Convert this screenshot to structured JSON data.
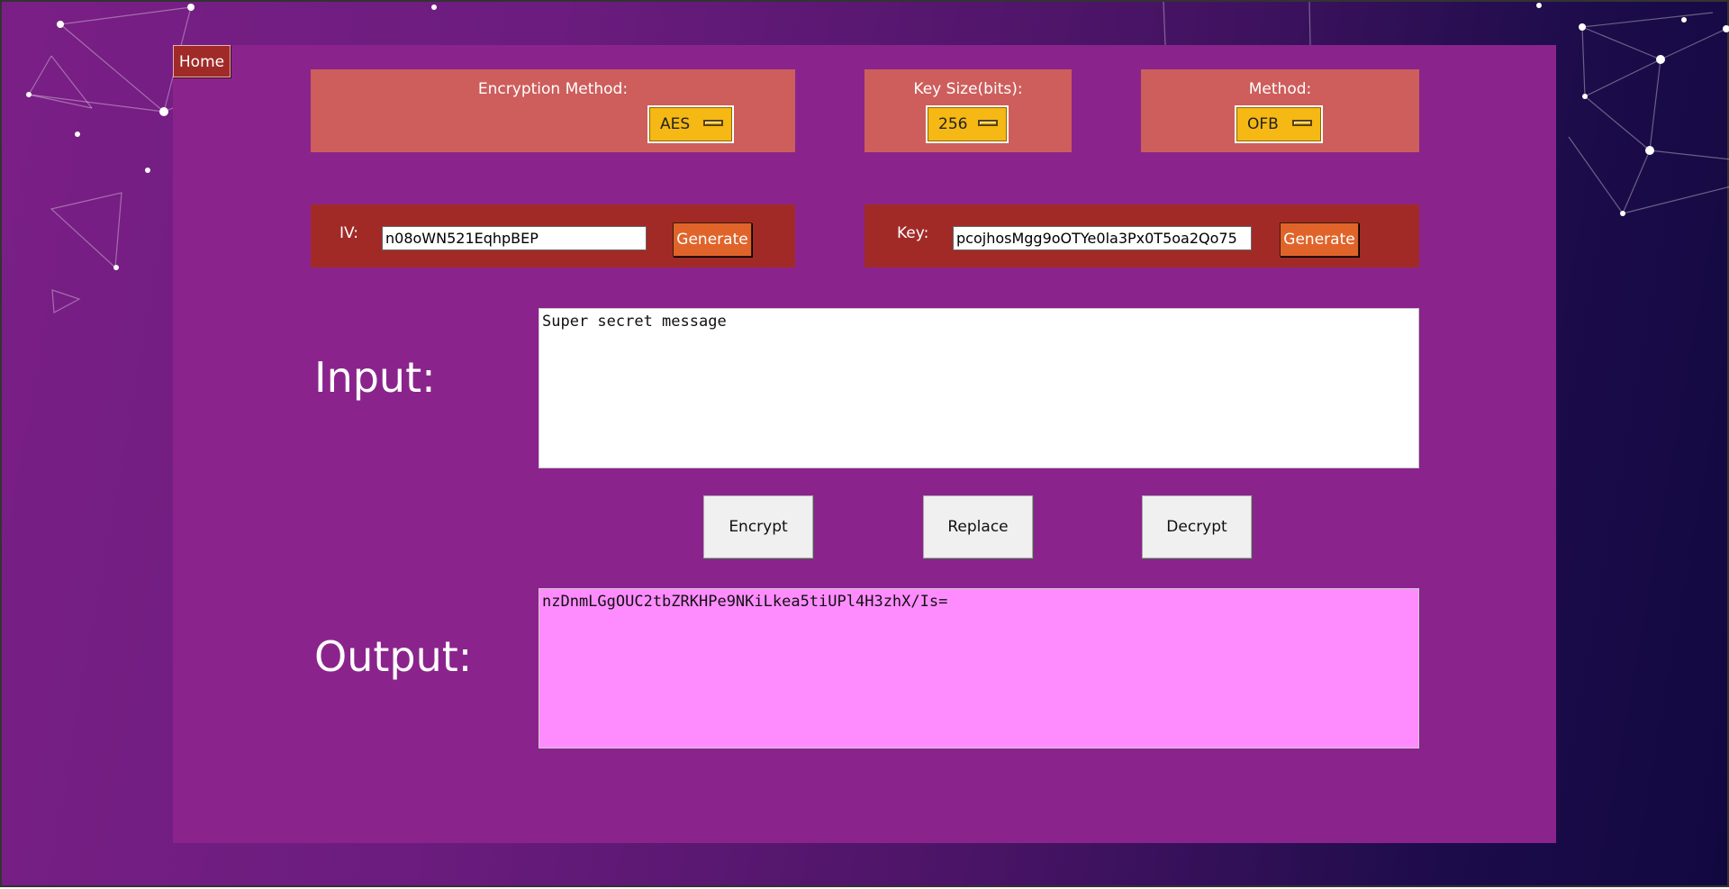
{
  "home": {
    "label": "Home"
  },
  "encryption_method": {
    "label": "Encryption Method:",
    "value": "AES"
  },
  "key_size": {
    "label": "Key Size(bits):",
    "value": "256"
  },
  "mode": {
    "label": "Method:",
    "value": "OFB"
  },
  "iv": {
    "label": "IV:",
    "value": "n08oWN521EqhpBEP",
    "generate_label": "Generate"
  },
  "key": {
    "label": "Key:",
    "value": "pcojhosMgg9oOTYe0la3Px0T5oa2Qo75",
    "generate_label": "Generate"
  },
  "input": {
    "label": "Input:",
    "value": "Super secret message"
  },
  "actions": {
    "encrypt": "Encrypt",
    "replace": "Replace",
    "decrypt": "Decrypt"
  },
  "output": {
    "label": "Output:",
    "value": "nzDnmLGgOUC2tbZRKHPe9NKiLkea5tiUPl4H3zhX/Is="
  },
  "colors": {
    "panel": "#8a248c",
    "header_box": "#cd5e5c",
    "field_box": "#a12a27",
    "dropdown": "#f5b814",
    "generate_button": "#e0642a",
    "output_bg": "#ff8cff"
  }
}
